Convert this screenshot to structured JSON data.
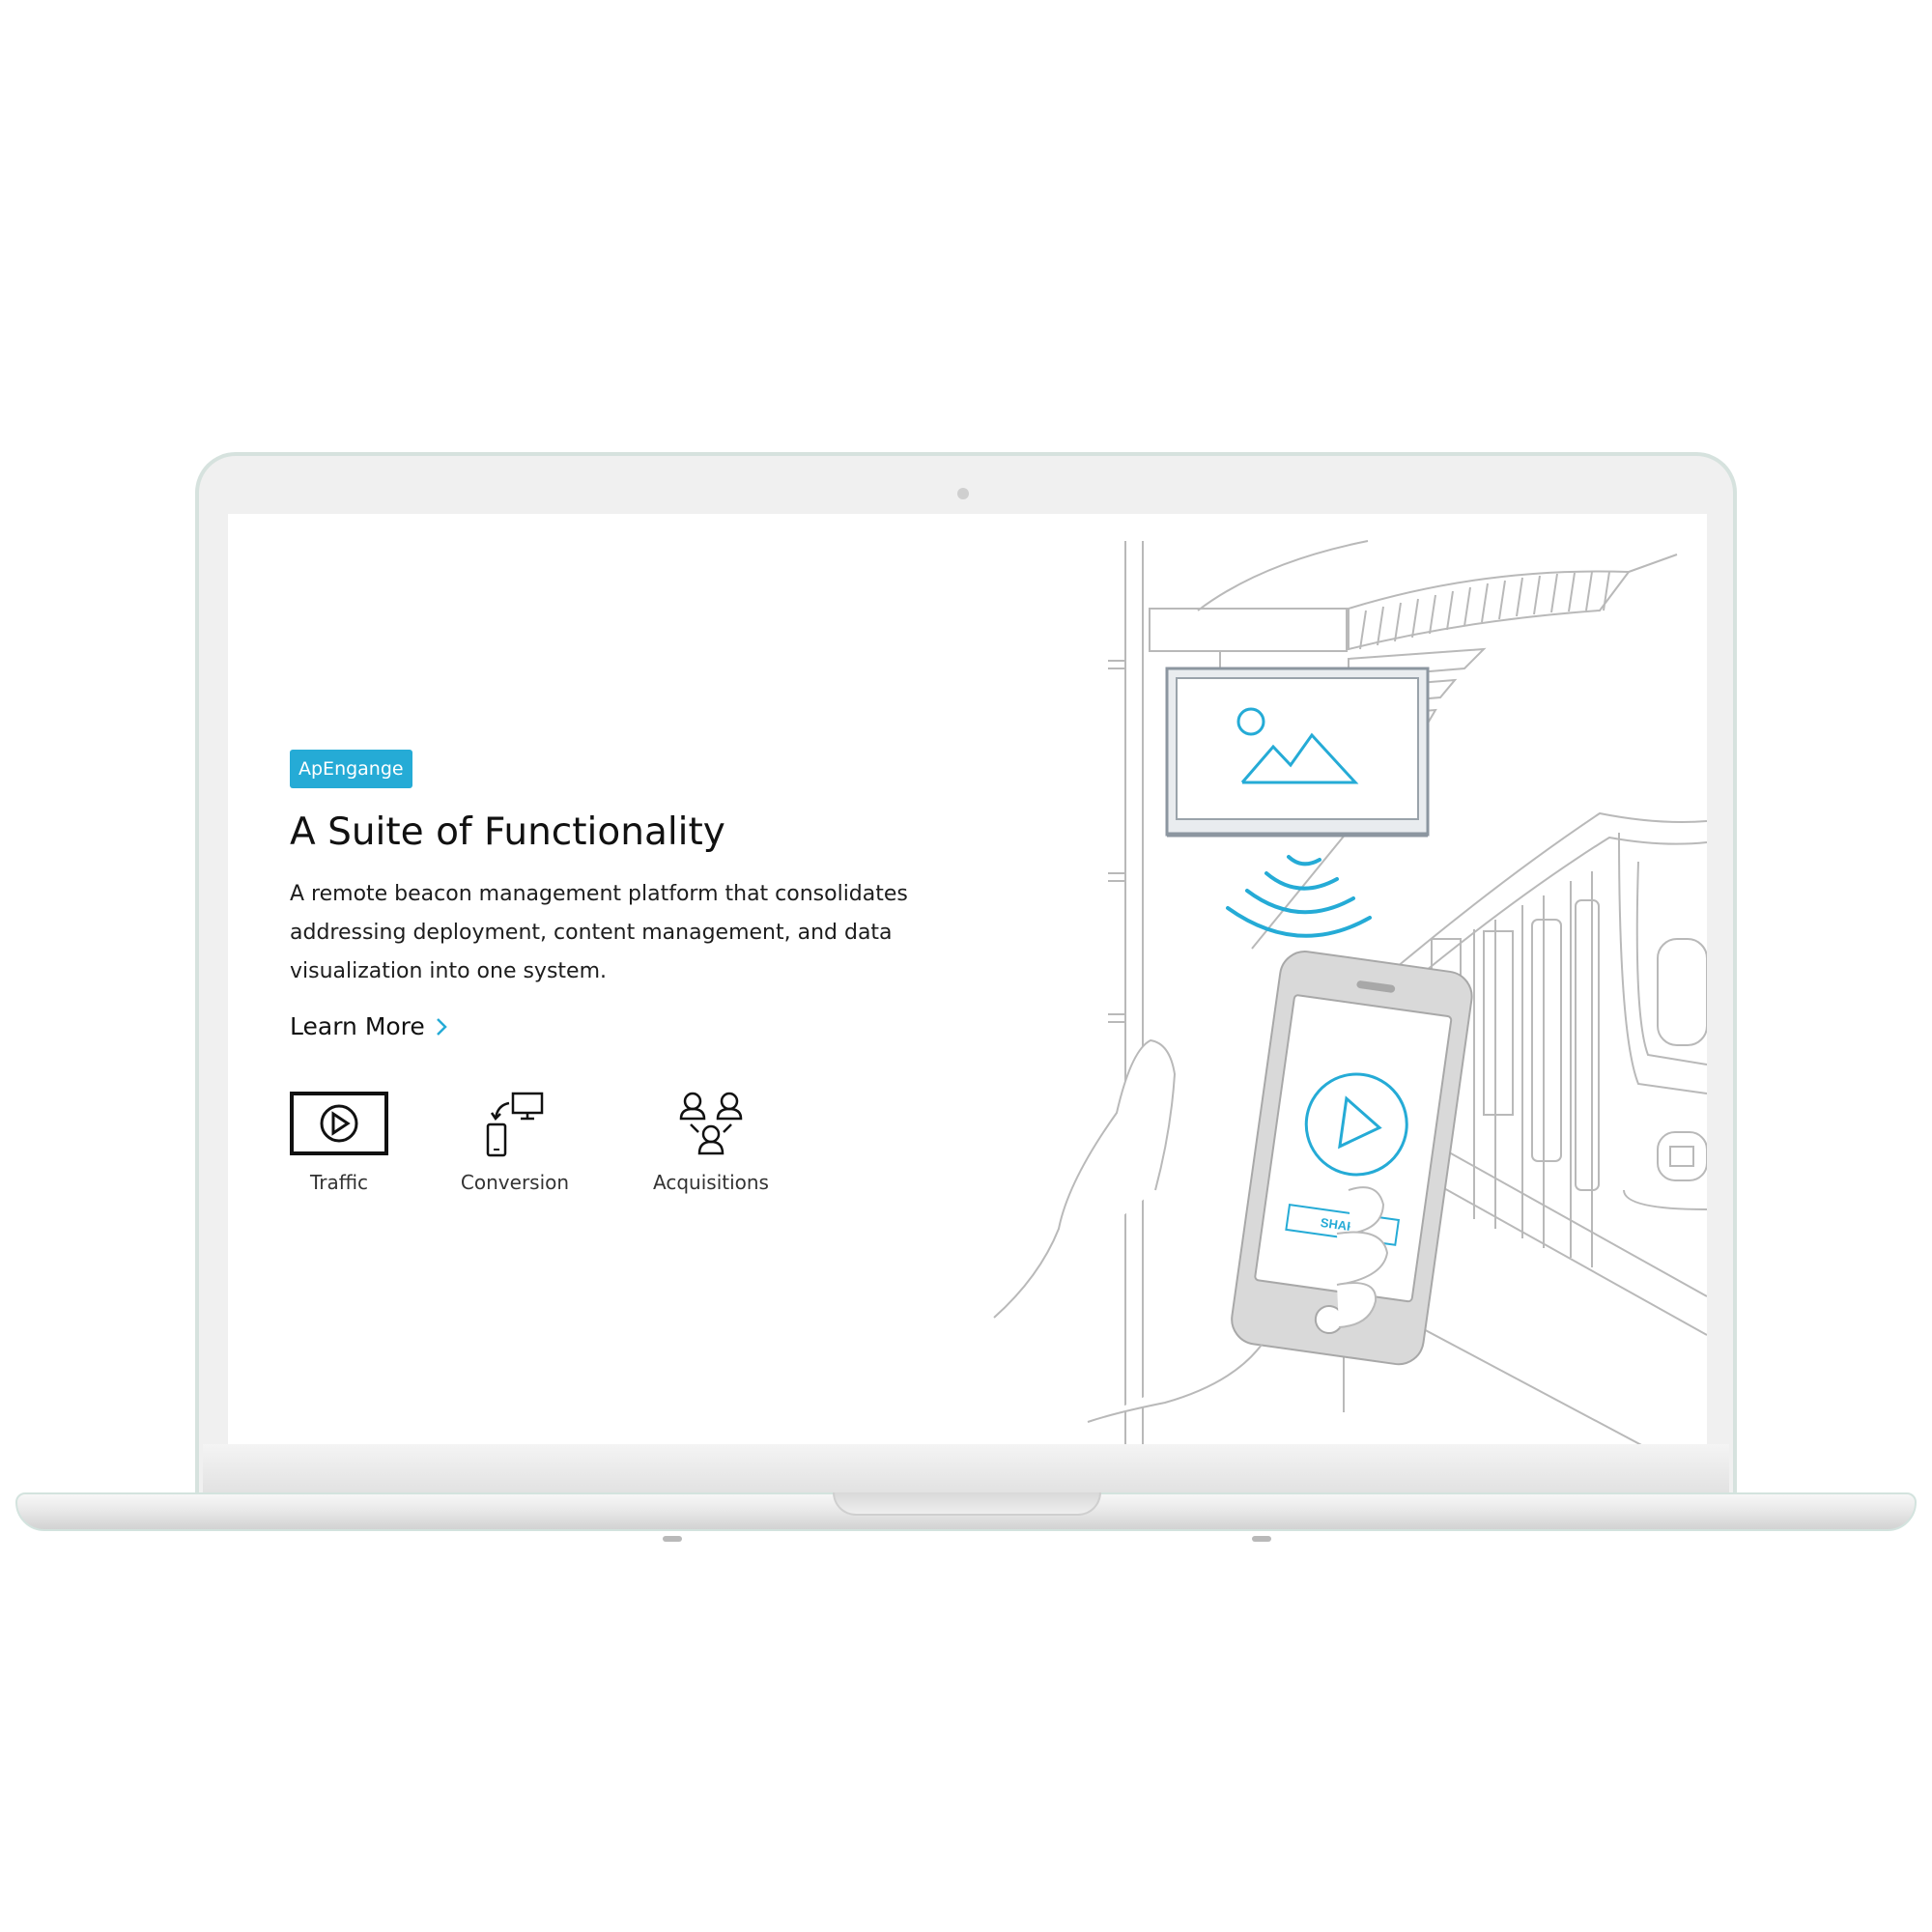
{
  "hero": {
    "badge": "ApEngange",
    "headline": "A Suite of Functionality",
    "description": "A remote beacon management platform that consolidates addressing deployment, content management, and data visualization into one system.",
    "cta_label": "Learn More"
  },
  "features": [
    {
      "label": "Traffic",
      "icon": "play-screen-icon"
    },
    {
      "label": "Conversion",
      "icon": "device-sync-icon"
    },
    {
      "label": "Acquisitions",
      "icon": "users-network-icon"
    }
  ],
  "illustration": {
    "share_label": "SHARE"
  },
  "colors": {
    "accent": "#25abd6",
    "text": "#111111",
    "line_art": "#b5b5b5"
  }
}
